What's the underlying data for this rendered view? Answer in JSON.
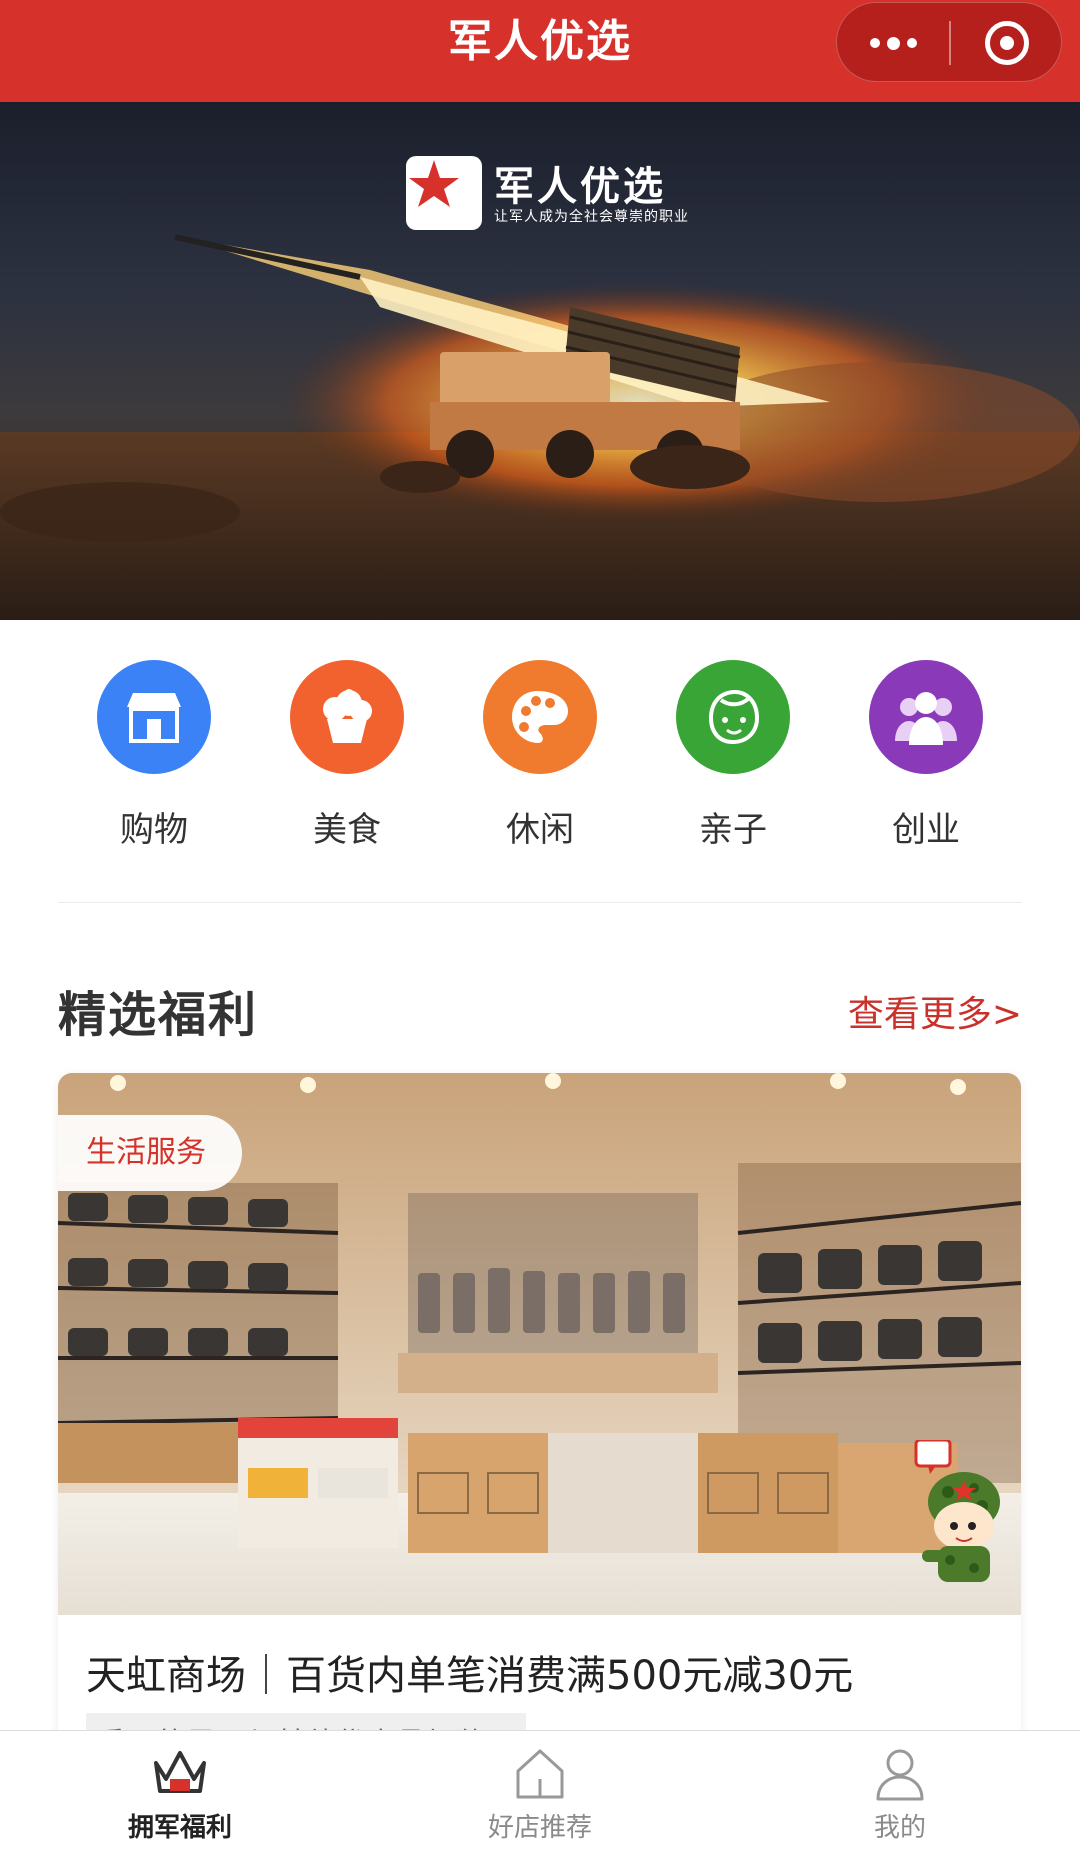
{
  "navbar": {
    "title": "军人优选",
    "more_icon": "more-dots-icon",
    "close_icon": "target-close-icon"
  },
  "banner": {
    "brand_name": "军人优选",
    "brand_slogan": "让军人成为全社会尊崇的职业"
  },
  "categories": [
    {
      "label": "购物",
      "icon": "store-icon",
      "color": "#3b82f6"
    },
    {
      "label": "美食",
      "icon": "cake-icon",
      "color": "#f2622e"
    },
    {
      "label": "休闲",
      "icon": "palette-icon",
      "color": "#f07a2e"
    },
    {
      "label": "亲子",
      "icon": "baby-face-icon",
      "color": "#3aa537"
    },
    {
      "label": "创业",
      "icon": "group-icon",
      "color": "#8a3ab9"
    }
  ],
  "section": {
    "title": "精选福利",
    "more": "查看更多>"
  },
  "card": {
    "tag": "生活服务",
    "title": "天虹商场｜百货内单笔消费满500元减30元",
    "subtitle": "重要的是可与其他优惠叠加使用"
  },
  "tabbar": {
    "items": [
      {
        "label": "拥军福利",
        "icon": "crown-icon",
        "active": true
      },
      {
        "label": "好店推荐",
        "icon": "house-icon",
        "active": false
      },
      {
        "label": "我的",
        "icon": "person-icon",
        "active": false
      }
    ]
  },
  "colors": {
    "brand_red": "#d6322b",
    "tab_inactive": "#8a8a8a"
  }
}
